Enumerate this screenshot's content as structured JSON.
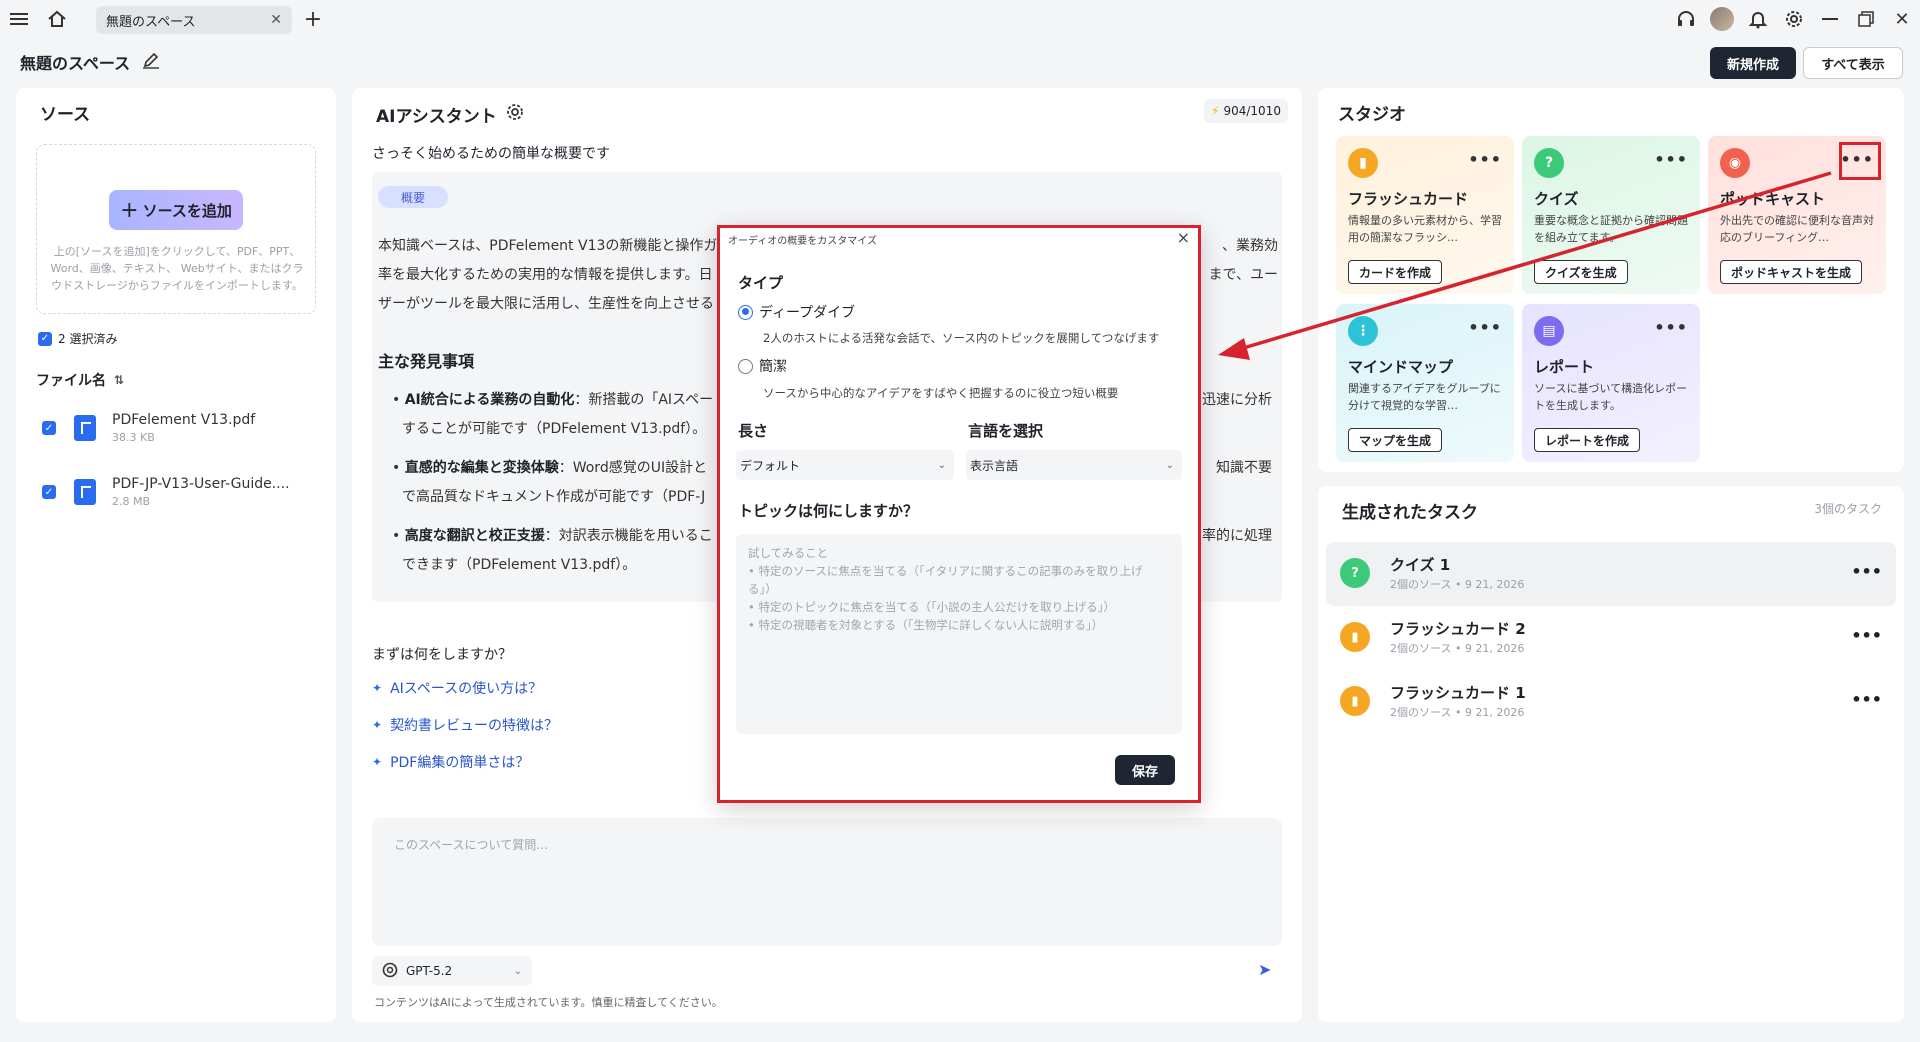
{
  "window": {
    "tab_title": "無題のスペース",
    "space_title": "無題のスペース",
    "new_button": "新規作成",
    "show_all_button": "すべて表示"
  },
  "sources": {
    "title": "ソース",
    "add_button": "ソースを追加",
    "hint": "上の[ソースを追加]をクリックして、PDF、PPT、Word、画像、テキスト、 Webサイト、またはクラウドストレージからファイルをインポートします。",
    "selected_label": "2 選択済み",
    "file_header": "ファイル名",
    "files": [
      {
        "name": "PDFelement V13.pdf",
        "size": "38.3 KB"
      },
      {
        "name": "PDF-JP-V13-User-Guide....",
        "size": "2.8 MB"
      }
    ]
  },
  "assistant": {
    "title": "AIアシスタント",
    "credits": "904/1010",
    "intro": "さっそく始めるための簡単な概要です",
    "tag": "概要",
    "summary_left": "本知識ベースは、PDFelement V13の新機能と操作ガ",
    "summary_right": "、業務効",
    "summary_line2_left": "率を最大化するための実用的な情報を提供します。日",
    "summary_line2_right": "まで、ユー",
    "summary_line3": "ザーがツールを最大限に活用し、生産性を向上させる",
    "findings_title": "主な発見事項",
    "bullets": [
      {
        "bold": "AI統合による業務の自動化",
        "text": "：新搭載の「AIスペー",
        "right": "迅速に分析",
        "line2": "することが可能です（PDFelement V13.pdf）。"
      },
      {
        "bold": "直感的な編集と変換体験",
        "text": "：Word感覚のUI設計と",
        "right": "知識不要",
        "line2": "で高品質なドキュメント作成が可能です（PDF-J"
      },
      {
        "bold": "高度な翻訳と校正支援",
        "text": "：対訳表示機能を用いるこ",
        "right": "率的に処理",
        "line2": "できます（PDFelement V13.pdf）。"
      }
    ],
    "next_question": "まずは何をしますか？",
    "suggestions": [
      "AIスペースの使い方は？",
      "契約書レビューの特徴は？",
      "PDF編集の簡単さは？"
    ],
    "chat_placeholder": "このスペースについて質問…",
    "model": "GPT-5.2",
    "disclaimer": "コンテンツはAIによって生成されています。慎重に精査してください。"
  },
  "studio": {
    "title": "スタジオ",
    "cards": [
      {
        "title": "フラッシュカード",
        "desc": "情報量の多い元素材から、学習用の簡潔なフラッシ…",
        "button": "カードを作成",
        "color": "#f5a623"
      },
      {
        "title": "クイズ",
        "desc": "重要な概念と証拠から確認問題を組み立てます。",
        "button": "クイズを生成",
        "color": "#3cc97a"
      },
      {
        "title": "ポッドキャスト",
        "desc": "外出先での確認に便利な音声対応のブリーフィング…",
        "button": "ポッドキャストを生成",
        "color": "#f0624d"
      },
      {
        "title": "マインドマップ",
        "desc": "関連するアイデアをグループに分けて視覚的な学習…",
        "button": "マップを生成",
        "color": "#2cc3d8"
      },
      {
        "title": "レポート",
        "desc": "ソースに基づいて構造化レポートを生成します。",
        "button": "レポートを作成",
        "color": "#7b6cf0"
      }
    ]
  },
  "tasks": {
    "title": "生成されたタスク",
    "count": "3個のタスク",
    "items": [
      {
        "name": "クイズ 1",
        "meta": "2個のソース • 9 21, 2026",
        "color": "#3cc97a"
      },
      {
        "name": "フラッシュカード 2",
        "meta": "2個のソース • 9 21, 2026",
        "color": "#f5a623"
      },
      {
        "name": "フラッシュカード 1",
        "meta": "2個のソース • 9 21, 2026",
        "color": "#f5a623"
      }
    ]
  },
  "modal": {
    "title": "オーディオの概要をカスタマイズ",
    "type_label": "タイプ",
    "options": [
      {
        "label": "ディープダイブ",
        "desc": "2人のホストによる活発な会話で、ソース内のトピックを展開してつなげます",
        "selected": true
      },
      {
        "label": "簡潔",
        "desc": "ソースから中心的なアイデアをすばやく把握するのに役立つ短い概要",
        "selected": false
      }
    ],
    "length_label": "長さ",
    "length_value": "デフォルト",
    "language_label": "言語を選択",
    "language_value": "表示言語",
    "topic_label": "トピックは何にしますか？",
    "topic_placeholder": "試してみること\n• 特定のソースに焦点を当てる（「イタリアに関するこの記事のみを取り上げる」）\n• 特定のトピックに焦点を当てる（「小説の主人公だけを取り上げる」）\n• 特定の視聴者を対象とする（「生物学に詳しくない人に説明する」）",
    "save_button": "保存"
  }
}
